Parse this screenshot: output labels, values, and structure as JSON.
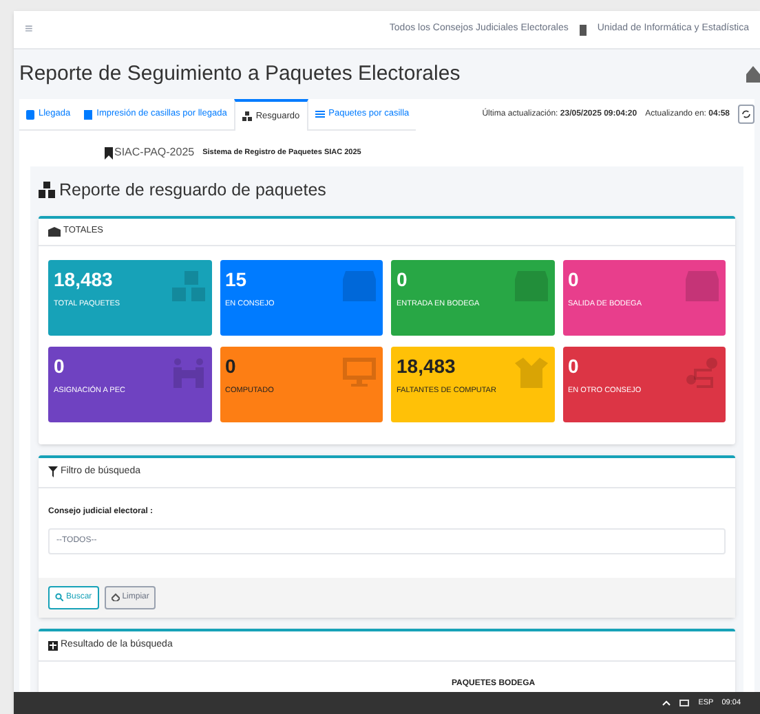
{
  "topbar": {
    "menu_icon": "≡",
    "council": "Todos los Consejos Judiciales Electorales",
    "unit": "Unidad de Informática y Estadística"
  },
  "page_title": "Reporte de Seguimiento a Paquetes Electorales",
  "tabs": [
    {
      "label": "Llegada",
      "selected": false
    },
    {
      "label": "Impresión de casillas por llegada",
      "selected": false
    },
    {
      "label": "Resguardo",
      "selected": true
    },
    {
      "label": "Paquetes por casilla",
      "selected": false
    }
  ],
  "update": {
    "label": "Última actualización:",
    "value": "23/05/2025 09:04:20",
    "countdown_label": "Actualizando en:",
    "countdown": "04:58"
  },
  "system": {
    "code": "SIAC-PAQ-2025",
    "name": "Sistema de Registro de Paquetes SIAC 2025"
  },
  "report_title": "Reporte de resguardo de paquetes",
  "totals": {
    "title": "TOTALES",
    "tiles": [
      {
        "value": "18,483",
        "label": "TOTAL PAQUETES",
        "color": "#17a2b8"
      },
      {
        "value": "15",
        "label": "EN CONSEJO",
        "color": "#007bff"
      },
      {
        "value": "0",
        "label": "ENTRADA EN BODEGA",
        "color": "#28a745"
      },
      {
        "value": "0",
        "label": "SALIDA DE BODEGA",
        "color": "#e83e8c"
      },
      {
        "value": "0",
        "label": "ASIGNACIÓN A PEC",
        "color": "#6f42c1"
      },
      {
        "value": "0",
        "label": "COMPUTADO",
        "color": "#fd7e14"
      },
      {
        "value": "18,483",
        "label": "FALTANTES DE COMPUTAR",
        "color": "#ffc107"
      },
      {
        "value": "0",
        "label": "EN OTRO CONSEJO",
        "color": "#dc3545"
      }
    ]
  },
  "filter": {
    "title": "Filtro de búsqueda",
    "field_label": "Consejo judicial electoral :",
    "field_value": "--TODOS--",
    "buttons": [
      {
        "label": "Buscar",
        "kind": "primary"
      },
      {
        "label": "Limpiar",
        "kind": "secondary"
      }
    ]
  },
  "results": {
    "title": "Resultado de la búsqueda",
    "column_header": "PAQUETES BODEGA"
  },
  "taskbar": {
    "language": "ESP",
    "time": "09:04"
  }
}
